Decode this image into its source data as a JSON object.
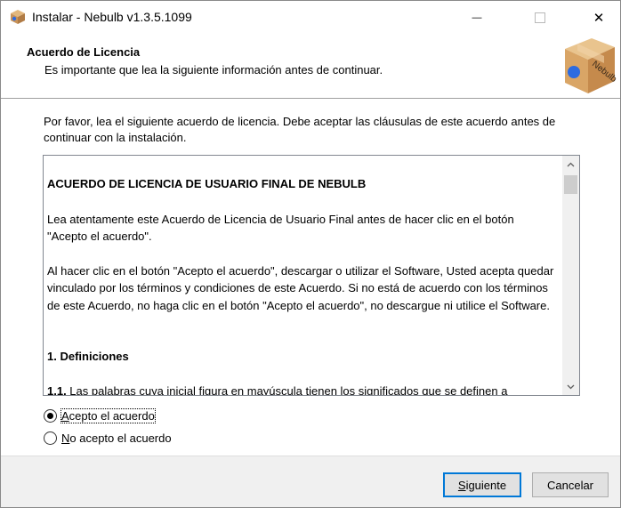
{
  "window": {
    "title": "Instalar - Nebulb v1.3.5.1099",
    "minimize_glyph": "—",
    "close_glyph": "✕"
  },
  "header": {
    "title": "Acuerdo de Licencia",
    "subtitle": "Es importante que lea la siguiente información antes de continuar.",
    "image_label": "Nebulb"
  },
  "intro": "Por favor, lea el siguiente acuerdo de licencia. Debe aceptar las cláusulas de este acuerdo antes de continuar con la instalación.",
  "license": {
    "title": "ACUERDO DE LICENCIA DE USUARIO FINAL DE NEBULB",
    "paragraph1": "Lea atentamente este Acuerdo de Licencia de Usuario Final antes de hacer clic en el botón \"Acepto el acuerdo\".",
    "paragraph2": "Al hacer clic en el botón \"Acepto el acuerdo\", descargar o utilizar el Software, Usted acepta quedar vinculado por los términos y condiciones de este Acuerdo. Si no está de acuerdo con los términos de este Acuerdo, no haga clic en el botón \"Acepto el acuerdo\", no descargue ni utilice el Software.",
    "section1_heading": "1. Definiciones",
    "clause_number": "1.1.",
    "clause_text": " Las palabras cuya inicial figura en mayúscula tienen los significados que se definen a"
  },
  "options": {
    "accept": {
      "first_letter": "A",
      "rest": "cepto el acuerdo",
      "selected": true
    },
    "decline": {
      "first_letter": "N",
      "rest": "o acepto el acuerdo",
      "selected": false
    }
  },
  "buttons": {
    "next": {
      "first_letter": "S",
      "rest": "iguiente"
    },
    "cancel": "Cancelar"
  },
  "colors": {
    "focus_border": "#0078d7",
    "footer_bg": "#f0f0f0",
    "button_bg": "#e1e1e1"
  }
}
